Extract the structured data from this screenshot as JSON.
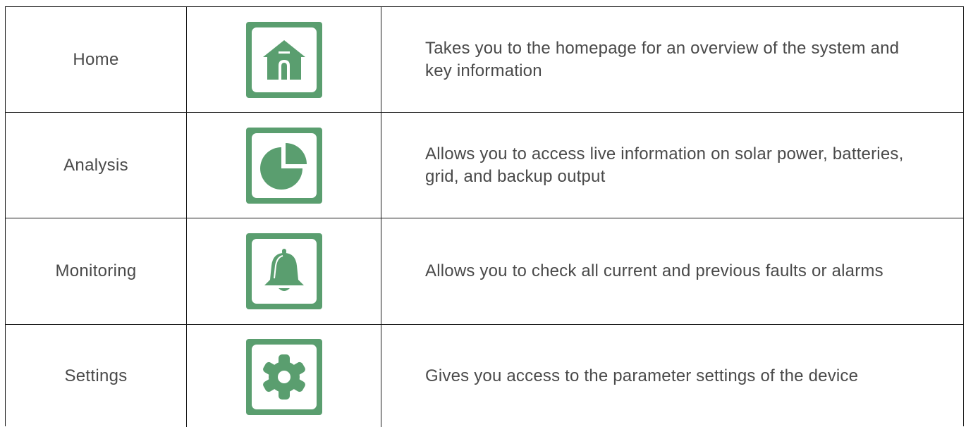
{
  "colors": {
    "accent": "#5a9e6f",
    "text": "#4a4a4a",
    "border": "#1a1a1a"
  },
  "rows": [
    {
      "name": "Home",
      "icon": "home-icon",
      "description": "Takes you to the homepage for an overview of the system and key information"
    },
    {
      "name": "Analysis",
      "icon": "pie-chart-icon",
      "description": "Allows you to access live information on solar power, batteries, grid, and backup output"
    },
    {
      "name": "Monitoring",
      "icon": "bell-icon",
      "description": "Allows you to check all current and previous faults or alarms"
    },
    {
      "name": "Settings",
      "icon": "gear-icon",
      "description": "Gives you access to the parameter settings of the device"
    }
  ]
}
